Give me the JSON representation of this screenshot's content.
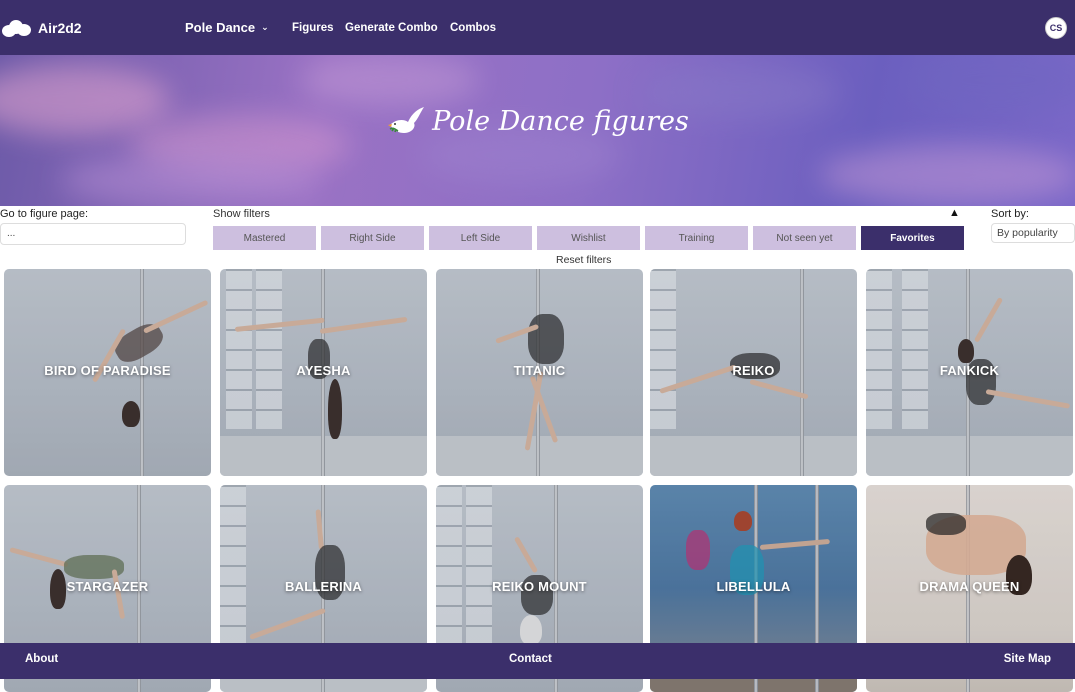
{
  "nav": {
    "brand": "Air2d2",
    "sport": "Pole Dance",
    "links": [
      "Figures",
      "Generate Combo",
      "Combos"
    ],
    "avatar_initials": "CS",
    "bg_color": "#3b2f6b"
  },
  "hero": {
    "title": "Pole Dance figures",
    "icon": "dove-icon"
  },
  "goto": {
    "label": "Go to figure page:",
    "value": "..."
  },
  "filters": {
    "toggle_label": "Show filters",
    "buttons": [
      "Mastered",
      "Right Side",
      "Left Side",
      "Wishlist",
      "Training",
      "Not seen yet",
      "Favorites"
    ],
    "active": "Favorites",
    "reset_label": "Reset filters"
  },
  "sort": {
    "label": "Sort by:",
    "value": "By popularity"
  },
  "figures": [
    "BIRD OF PARADISE",
    "AYESHA",
    "TITANIC",
    "REIKO",
    "FANKICK",
    "STARGAZER",
    "BALLERINA",
    "REIKO MOUNT",
    "LIBELLULA",
    "DRAMA QUEEN"
  ],
  "footer": {
    "about": "About",
    "contact": "Contact",
    "sitemap": "Site Map"
  }
}
